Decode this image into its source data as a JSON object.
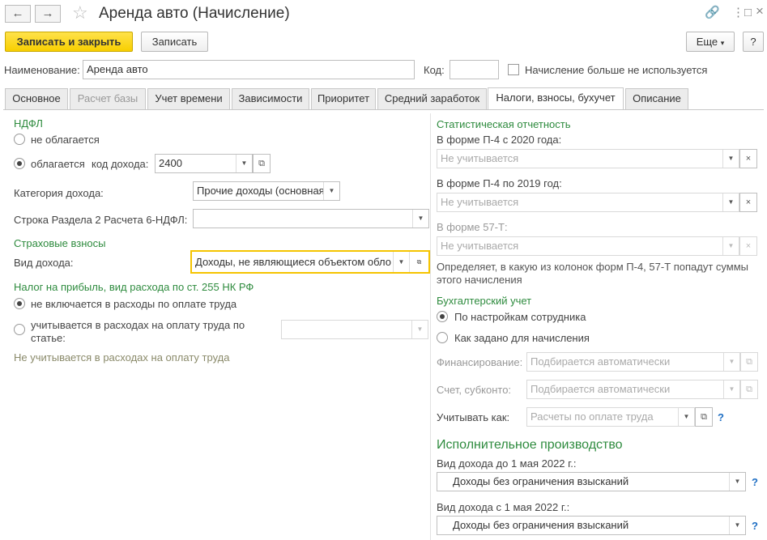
{
  "window": {
    "title": "Аренда авто (Начисление)",
    "nav_back": "←",
    "nav_forward": "→",
    "star_icon": "☆",
    "link_icon": "🔗",
    "more_icon": "⋮",
    "restore_icon": "□",
    "close_icon": "×"
  },
  "toolbar": {
    "save_close": "Записать и закрыть",
    "save": "Записать",
    "more": "Еще",
    "more_arrow": "▾",
    "help": "?"
  },
  "header": {
    "name_label": "Наименование:",
    "name_value": "Аренда авто",
    "code_label": "Код:",
    "code_value": "",
    "unused_label": "Начисление больше не используется",
    "unused_checked": false
  },
  "tabs": [
    {
      "label": "Основное",
      "state": "normal"
    },
    {
      "label": "Расчет базы",
      "state": "disabled"
    },
    {
      "label": "Учет времени",
      "state": "normal"
    },
    {
      "label": "Зависимости",
      "state": "normal"
    },
    {
      "label": "Приоритет",
      "state": "normal"
    },
    {
      "label": "Средний заработок",
      "state": "normal"
    },
    {
      "label": "Налоги, взносы, бухучет",
      "state": "active"
    },
    {
      "label": "Описание",
      "state": "normal"
    }
  ],
  "left": {
    "ndfl_title": "НДФЛ",
    "not_taxed": "не облагается",
    "taxed": "облагается",
    "income_code_label": "код дохода:",
    "income_code_value": "2400",
    "income_category_label": "Категория дохода:",
    "income_category_value": "Прочие доходы (основная",
    "line6ndfl_label": "Строка Раздела 2 Расчета 6-НДФЛ:",
    "line6ndfl_value": "",
    "insurance_title": "Страховые взносы",
    "income_type_label": "Вид дохода:",
    "income_type_value": "Доходы, не являющиеся объектом обло",
    "profit_tax_title": "Налог на прибыль, вид расхода по ст. 255 НК РФ",
    "not_included": "не включается в расходы по оплате труда",
    "included_line1": "учитывается в расходах на оплату труда по",
    "included_line2": "статье:",
    "article_value": "",
    "not_counted_note": "Не учитывается в расходах на оплату труда"
  },
  "right": {
    "stat_title": "Статистическая отчетность",
    "p4_2020_label": "В форме П-4 с 2020 года:",
    "p4_2020_placeholder": "Не учитывается",
    "p4_2019_label": "В форме П-4 по 2019 год:",
    "p4_2019_placeholder": "Не учитывается",
    "f57t_label": "В форме 57-Т:",
    "f57t_placeholder": "Не учитывается",
    "stat_hint": "Определяет, в какую из колонок форм П-4, 57-Т попадут суммы этого начисления",
    "acc_title": "Бухгалтерский учет",
    "by_employee": "По настройкам сотрудника",
    "as_set": "Как задано для начисления",
    "financing_label": "Финансирование:",
    "financing_placeholder": "Подбирается автоматически",
    "account_label": "Счет, субконто:",
    "account_placeholder": "Подбирается автоматически",
    "account_as_label": "Учитывать как:",
    "account_as_placeholder": "Расчеты по оплате труда",
    "exec_title": "Исполнительное производство",
    "before_may_label": "Вид дохода до 1 мая 2022 г.:",
    "before_may_value": "Доходы без ограничения взысканий",
    "after_may_label": "Вид дохода с 1 мая 2022 г.:",
    "after_may_value": "Доходы без ограничения взысканий",
    "help_mark": "?"
  },
  "icons": {
    "dropdown": "▼",
    "open": "⧉",
    "clear": "×"
  }
}
